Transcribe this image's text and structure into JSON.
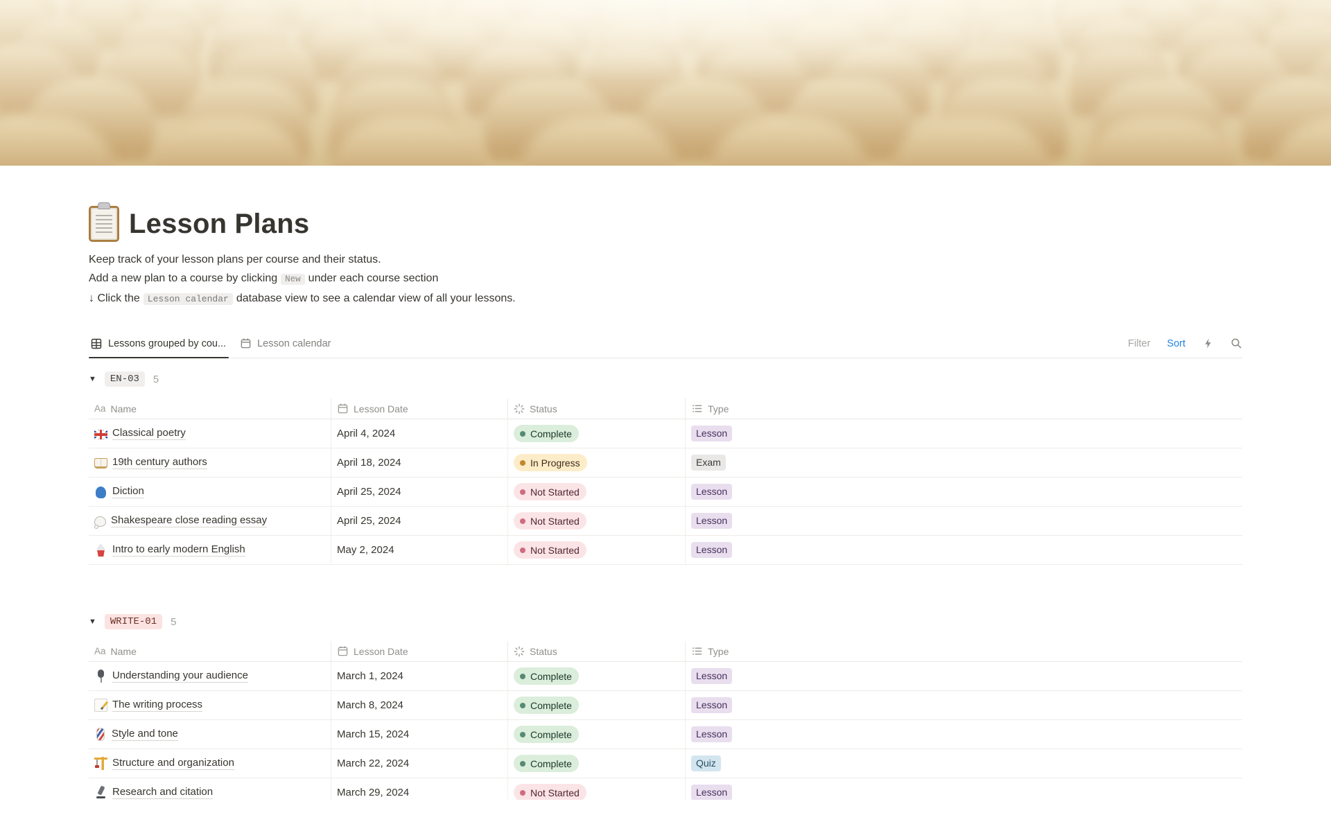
{
  "page": {
    "icon": "clipboard",
    "title": "Lesson Plans",
    "description": [
      {
        "prefix": "Keep track of your lesson plans per course and their status.",
        "chip": "",
        "suffix": ""
      },
      {
        "prefix": "Add a new plan to a course by clicking",
        "chip": "New",
        "suffix": "under each course section"
      },
      {
        "prefix": "↓ Click the",
        "chip": "Lesson calendar",
        "suffix": "database view to see a calendar view of all your lessons."
      }
    ]
  },
  "toolbar": {
    "tabs": [
      {
        "label": "Lessons grouped by cou...",
        "icon": "table-icon",
        "active": true
      },
      {
        "label": "Lesson calendar",
        "icon": "calendar-icon",
        "active": false
      }
    ],
    "filter_label": "Filter",
    "sort_label": "Sort",
    "sort_color": "#2383E2"
  },
  "table": {
    "columns": [
      {
        "label": "Name",
        "icon": "text-icon"
      },
      {
        "label": "Lesson Date",
        "icon": "calendar-icon"
      },
      {
        "label": "Status",
        "icon": "status-icon"
      },
      {
        "label": "Type",
        "icon": "list-icon"
      }
    ]
  },
  "groups": [
    {
      "tag": "EN-03",
      "count": "5",
      "tag_bg": "#F0EFED",
      "tag_text": "#3F3D39",
      "rows": [
        {
          "emoji": "🇬🇧",
          "emoji_name": "uk-flag",
          "name": "Classical poetry",
          "date": "April 4, 2024",
          "status": "Complete",
          "type": "Lesson"
        },
        {
          "emoji": "📖",
          "emoji_name": "open-book",
          "name": "19th century authors",
          "date": "April 18, 2024",
          "status": "In Progress",
          "type": "Exam"
        },
        {
          "emoji": "🗣️",
          "emoji_name": "speaking-head",
          "name": "Diction",
          "date": "April 25, 2024",
          "status": "Not Started",
          "type": "Lesson"
        },
        {
          "emoji": "💭",
          "emoji_name": "thought-balloon",
          "name": "Shakespeare close reading essay",
          "date": "April 25, 2024",
          "status": "Not Started",
          "type": "Lesson"
        },
        {
          "emoji": "🚀",
          "emoji_name": "rocket",
          "name": "Intro to early modern English",
          "date": "May 2, 2024",
          "status": "Not Started",
          "type": "Lesson"
        }
      ]
    },
    {
      "tag": "WRITE-01",
      "count": "5",
      "tag_bg": "#FBE3E2",
      "tag_text": "#6E2E26",
      "rows": [
        {
          "emoji": "🎙️",
          "emoji_name": "microphone",
          "name": "Understanding your audience",
          "date": "March 1, 2024",
          "status": "Complete",
          "type": "Lesson"
        },
        {
          "emoji": "📝",
          "emoji_name": "memo",
          "name": "The writing process",
          "date": "March 8, 2024",
          "status": "Complete",
          "type": "Lesson"
        },
        {
          "emoji": "💈",
          "emoji_name": "barber-pole",
          "name": "Style and tone",
          "date": "March 15, 2024",
          "status": "Complete",
          "type": "Lesson"
        },
        {
          "emoji": "🏗️",
          "emoji_name": "crane",
          "name": "Structure and organization",
          "date": "March 22, 2024",
          "status": "Complete",
          "type": "Quiz"
        },
        {
          "emoji": "🔬",
          "emoji_name": "microscope",
          "name": "Research and citation",
          "date": "March 29, 2024",
          "status": "Not Started",
          "type": "Lesson"
        }
      ]
    }
  ],
  "status_styles": {
    "Complete": {
      "bg": "#DBEDDB",
      "dot": "#568A72",
      "text": "#1C3829"
    },
    "In Progress": {
      "bg": "#FDECC8",
      "dot": "#C4862B",
      "text": "#402C1B"
    },
    "Not Started": {
      "bg": "#FBE4E6",
      "dot": "#CF6C80",
      "text": "#4F2530"
    }
  },
  "type_styles": {
    "Lesson": {
      "bg": "#E8DEEE",
      "text": "#49305E"
    },
    "Exam": {
      "bg": "#E9E8E6",
      "text": "#3D3B37"
    },
    "Quiz": {
      "bg": "#D3E5EF",
      "text": "#264E63"
    }
  }
}
